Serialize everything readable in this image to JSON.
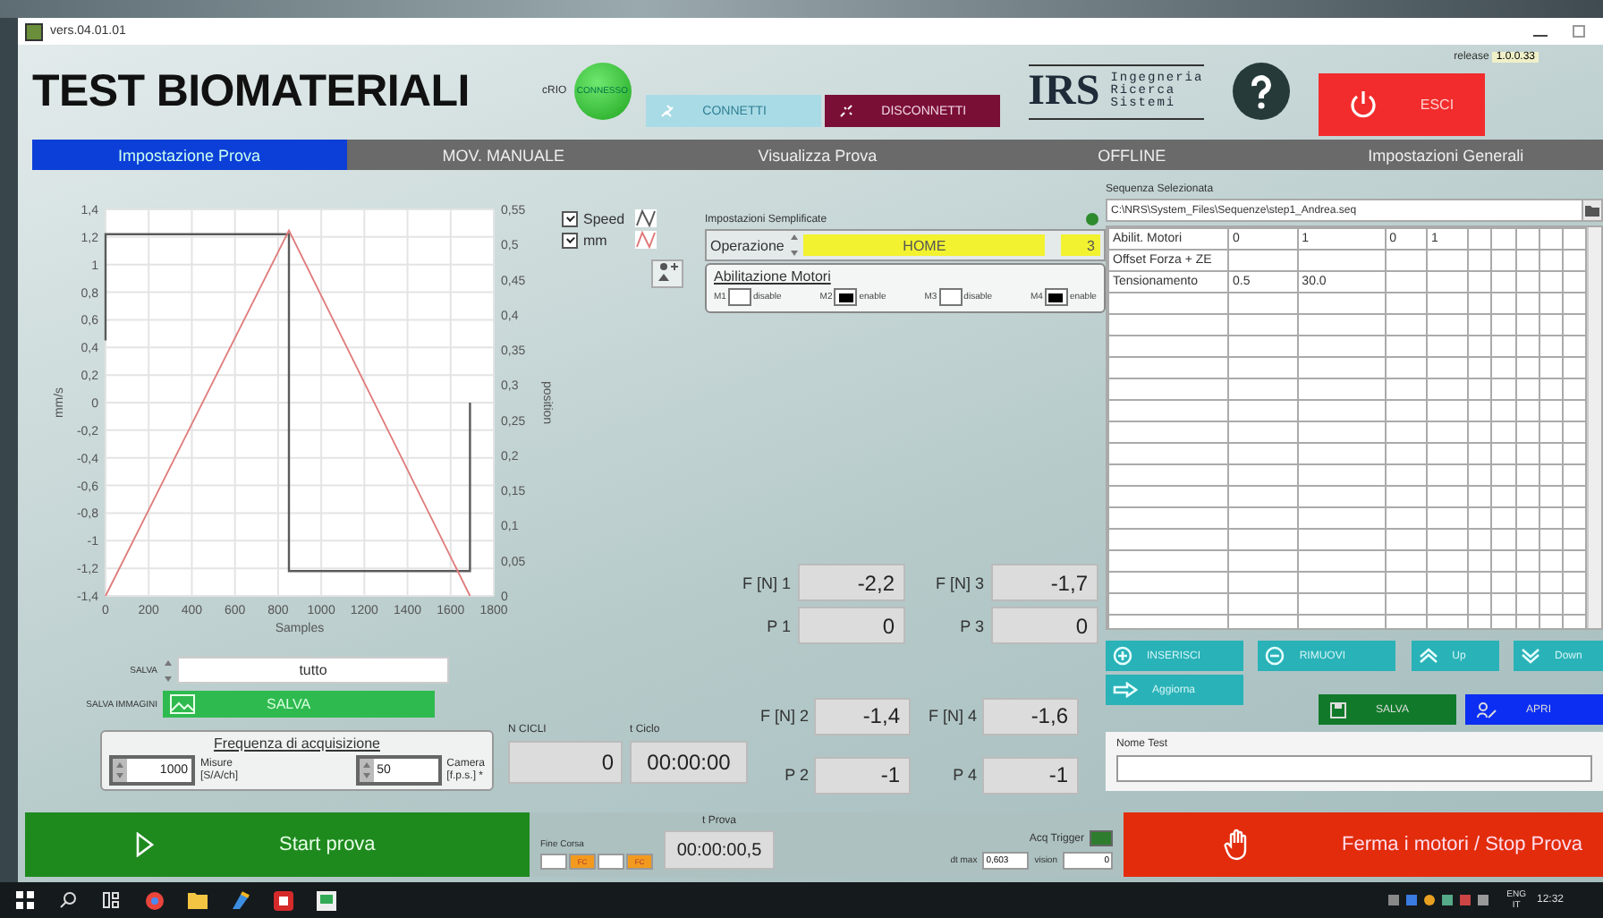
{
  "window": {
    "title": "vers.04.01.01"
  },
  "header": {
    "title": "TEST BIOMATERIALI",
    "crio": {
      "label": "cRIO",
      "status": "CONNESSO",
      "connected": true
    },
    "connect_button": {
      "label": "CONNETTI",
      "disabled": true
    },
    "disconnect_button": {
      "label": "DISCONNETTI",
      "disabled": false
    },
    "logo": {
      "mark": "IRS",
      "lines": [
        "Ingegneria",
        "Ricerca",
        "Sistemi"
      ]
    },
    "release": {
      "label": "release",
      "value": "1.0.0.33"
    },
    "exit_button": {
      "label": "ESCI"
    }
  },
  "tabs": [
    {
      "label": "Impostazione Prova",
      "selected": true
    },
    {
      "label": "MOV. MANUALE",
      "selected": false
    },
    {
      "label": "Visualizza Prova",
      "selected": false
    },
    {
      "label": "OFFLINE",
      "selected": false
    },
    {
      "label": "Impostazioni Generali",
      "selected": false
    }
  ],
  "chart": {
    "legend": [
      {
        "checked": true
      },
      {
        "checked": true
      }
    ],
    "chart_data": {
      "type": "line",
      "grid": true,
      "xlabel": "Samples",
      "ylabel": "mm/s",
      "y2label": "position",
      "x": [
        0,
        0,
        850,
        850,
        1690,
        1690
      ],
      "series": [
        {
          "name": "Speed",
          "color": "#5a5a5a",
          "values": [
            0.45,
            1.22,
            1.22,
            -1.22,
            -1.22,
            0
          ]
        },
        {
          "name": "mm",
          "color": "#e07a7a",
          "axis": "y2",
          "values": [
            0,
            0,
            0.52,
            0.52,
            0,
            0
          ]
        }
      ],
      "xlim": [
        0,
        1800
      ],
      "ylim": [
        -1.4,
        1.4
      ],
      "y2lim": [
        0,
        0.55
      ],
      "xticks": [
        0,
        200,
        400,
        600,
        800,
        1000,
        1200,
        1400,
        1600,
        1800
      ],
      "yticks": [
        {
          "value": 1.4,
          "label": "1,4"
        },
        {
          "value": 1.2,
          "label": "1,2"
        },
        {
          "value": 1,
          "label": "1"
        },
        {
          "value": 0.8,
          "label": "0,8"
        },
        {
          "value": 0.6,
          "label": "0,6"
        },
        {
          "value": 0.4,
          "label": "0,4"
        },
        {
          "value": 0.2,
          "label": "0,2"
        },
        {
          "value": 0,
          "label": "0"
        },
        {
          "value": -0.2,
          "label": "-0,2"
        },
        {
          "value": -0.4,
          "label": "-0,4"
        },
        {
          "value": -0.6,
          "label": "-0,6"
        },
        {
          "value": -0.8,
          "label": "-0,8"
        },
        {
          "value": -1,
          "label": "-1"
        },
        {
          "value": -1.2,
          "label": "-1,2"
        },
        {
          "value": -1.4,
          "label": "-1,4"
        }
      ],
      "y2ticks": [
        {
          "value": 0.55,
          "label": "0,55"
        },
        {
          "value": 0.5,
          "label": "0,5"
        },
        {
          "value": 0.45,
          "label": "0,45"
        },
        {
          "value": 0.4,
          "label": "0,4"
        },
        {
          "value": 0.35,
          "label": "0,35"
        },
        {
          "value": 0.3,
          "label": "0,3"
        },
        {
          "value": 0.25,
          "label": "0,25"
        },
        {
          "value": 0.2,
          "label": "0,2"
        },
        {
          "value": 0.15,
          "label": "0,15"
        },
        {
          "value": 0.1,
          "label": "0,1"
        },
        {
          "value": 0.05,
          "label": "0,05"
        },
        {
          "value": 0,
          "label": "0"
        }
      ]
    }
  },
  "settings": {
    "title": "Impostazioni Semplificate",
    "led_on": true,
    "operation": {
      "label": "Operazione",
      "value": "HOME",
      "index": "3"
    },
    "motors": {
      "title": "Abilitazione Motori",
      "items": [
        {
          "label": "M1",
          "state": "disable",
          "checked": false
        },
        {
          "label": "M2",
          "state": "enable",
          "checked": true
        },
        {
          "label": "M3",
          "state": "disable",
          "checked": false
        },
        {
          "label": "M4",
          "state": "enable",
          "checked": true
        }
      ]
    }
  },
  "readings_top": [
    {
      "label": "F [N] 1",
      "value": "-2,2"
    },
    {
      "label": "F [N] 3",
      "value": "-1,7"
    },
    {
      "label": "P 1",
      "value": "0"
    },
    {
      "label": "P 3",
      "value": "0"
    }
  ],
  "readings_bottom": [
    {
      "label": "F [N] 2",
      "value": "-1,4"
    },
    {
      "label": "F [N] 4",
      "value": "-1,6"
    },
    {
      "label": "P 2",
      "value": "-1"
    },
    {
      "label": "P 4",
      "value": "-1"
    }
  ],
  "save": {
    "label": "SALVA",
    "value": "tutto"
  },
  "save_image": {
    "label": "SALVA IMMAGINI",
    "button": "SALVA"
  },
  "frequency": {
    "title": "Frequenza di acquisizione",
    "measures": {
      "value": "1000",
      "label": "Misure",
      "unit": "[S/A/ch]"
    },
    "camera": {
      "value": "50",
      "label": "Camera",
      "unit": "[f.p.s.] *"
    }
  },
  "cycles": {
    "label": "N CICLI",
    "value": "0"
  },
  "cycle_time": {
    "label": "t Ciclo",
    "value": "00:00:00"
  },
  "sequence": {
    "label": "Sequenza Selezionata",
    "path": "C:\\NRS\\System_Files\\Sequenze\\step1_Andrea.seq",
    "rows": [
      {
        "cells": [
          "Abilit. Motori",
          "0",
          "1",
          "0",
          "1"
        ]
      },
      {
        "cells": [
          "Offset Forza + ZE"
        ]
      },
      {
        "cells": [
          "Tensionamento",
          "0.5",
          "30.0"
        ]
      }
    ]
  },
  "sequence_buttons": [
    {
      "label": "INSERISCI",
      "kind": "insert"
    },
    {
      "label": "RIMUOVI",
      "kind": "remove"
    },
    {
      "label": "Up",
      "kind": "up"
    },
    {
      "label": "Down",
      "kind": "down"
    },
    {
      "label": "Aggiorna",
      "kind": "update"
    }
  ],
  "file_buttons": [
    {
      "label": "SALVA",
      "kind": "save"
    },
    {
      "label": "APRI",
      "kind": "open"
    }
  ],
  "test_name": {
    "label": "Nome Test"
  },
  "start_button": {
    "label": "Start prova"
  },
  "limit_switches": {
    "label": "Fine Corsa",
    "lights": [
      {
        "on": false
      },
      {
        "text": "FC",
        "on": true
      },
      {
        "on": false
      },
      {
        "text": "FC",
        "on": true
      }
    ]
  },
  "test_time": {
    "label": "t Prova",
    "value": "00:00:00,5"
  },
  "trigger": {
    "label": "Acq Trigger",
    "on": true
  },
  "dt_max": {
    "label": "dt max",
    "value": "0,603"
  },
  "vision": {
    "label": "vision",
    "value": "0"
  },
  "stop_button": {
    "label": "Ferma i motori / Stop Prova"
  },
  "taskbar": {
    "language": "ENG",
    "region": "IT",
    "time": "12:32"
  }
}
